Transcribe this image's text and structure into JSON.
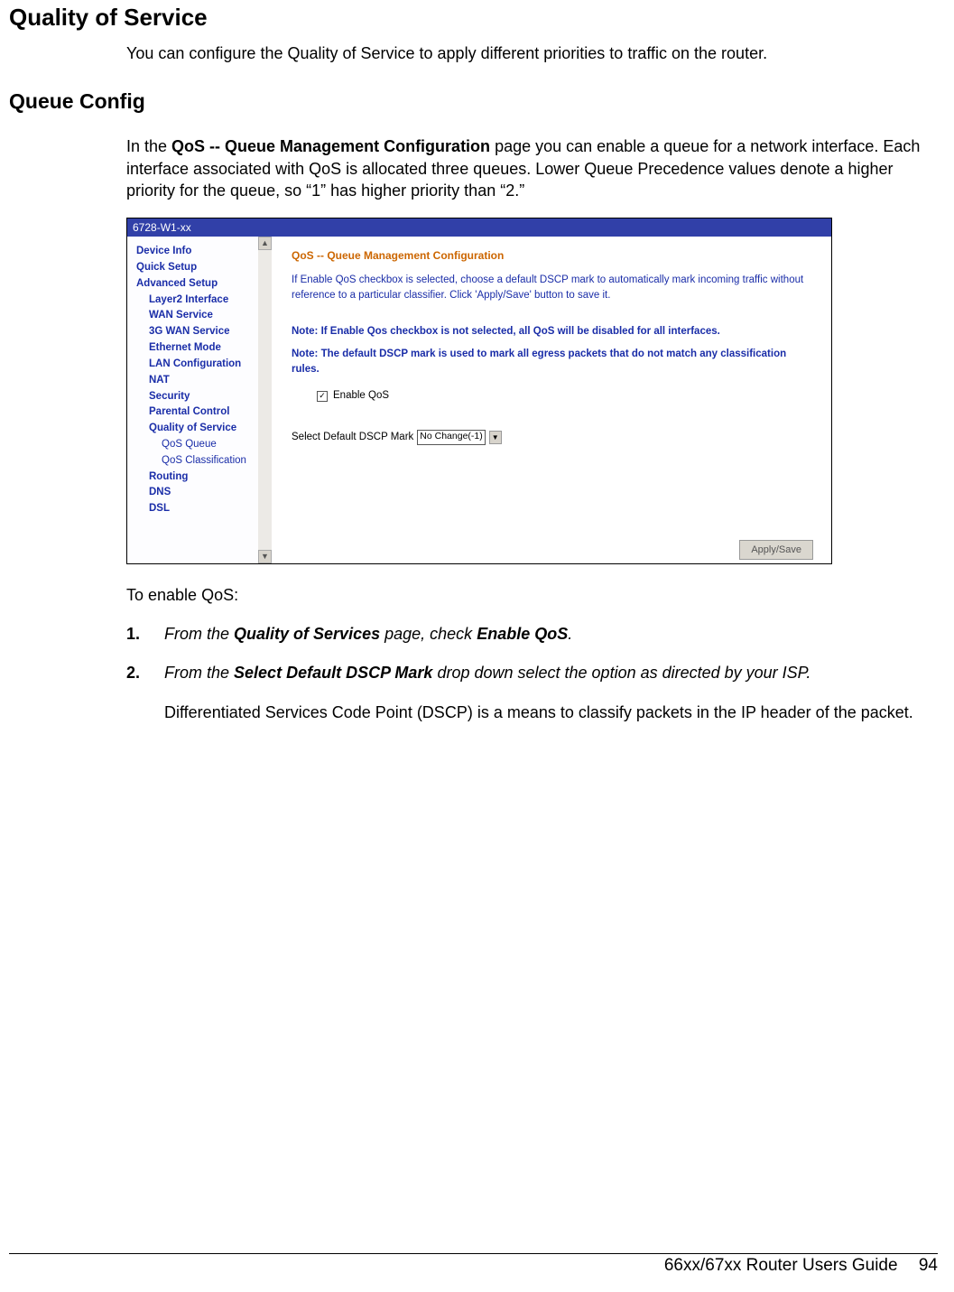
{
  "heading1": "Quality of Service",
  "intro": "You can configure the Quality of Service to apply different priorities to traffic on the router.",
  "heading2": "Queue Config",
  "queue_para_pre": "In the ",
  "queue_para_bold": "QoS -- Queue Management Configuration",
  "queue_para_post": " page you can enable a queue for a network interface. Each interface associated with QoS is allocated three queues. Lower Queue Precedence values denote a higher priority for the queue, so “1” has higher priority than “2.”",
  "screenshot": {
    "header": "6728-W1-xx",
    "nav_top": [
      "Device Info",
      "Quick Setup",
      "Advanced Setup"
    ],
    "nav_sub": [
      "Layer2 Interface",
      "WAN Service",
      "3G WAN Service",
      "Ethernet Mode",
      "LAN Configuration",
      "NAT",
      "Security",
      "Parental Control",
      "Quality of Service"
    ],
    "nav_sub2": [
      "QoS Queue",
      "QoS Classification"
    ],
    "nav_sub_after": [
      "Routing",
      "DNS",
      "DSL"
    ],
    "main_title": "QoS -- Queue Management Configuration",
    "main_p": "If Enable QoS checkbox is selected, choose a default DSCP mark to automatically mark incoming traffic without reference to a particular classifier. Click 'Apply/Save' button to save it.",
    "note1": "Note: If Enable Qos checkbox is not selected, all QoS will be disabled for all interfaces.",
    "note2": "Note: The default DSCP mark is used to mark all egress packets that do not match any classification rules.",
    "enable_label": "Enable QoS",
    "dscp_label": "Select Default DSCP Mark",
    "dscp_value": "No Change(-1)",
    "apply_label": "Apply/Save"
  },
  "toenable": "To enable QoS:",
  "step1_num": "1.",
  "step1_pre": "From the ",
  "step1_b1": "Quality of Services",
  "step1_mid": " page, check ",
  "step1_b2": "Enable QoS",
  "step1_post": ".",
  "step2_num": "2.",
  "step2_pre": "From the ",
  "step2_b1": "Select Default DSCP Mark",
  "step2_post": " drop down select the option as directed by your ISP.",
  "step2_note": "Differentiated Services Code Point (DSCP) is a means to classify packets in the IP header of the packet.",
  "footer_text": "66xx/67xx Router Users Guide",
  "footer_page": "94"
}
